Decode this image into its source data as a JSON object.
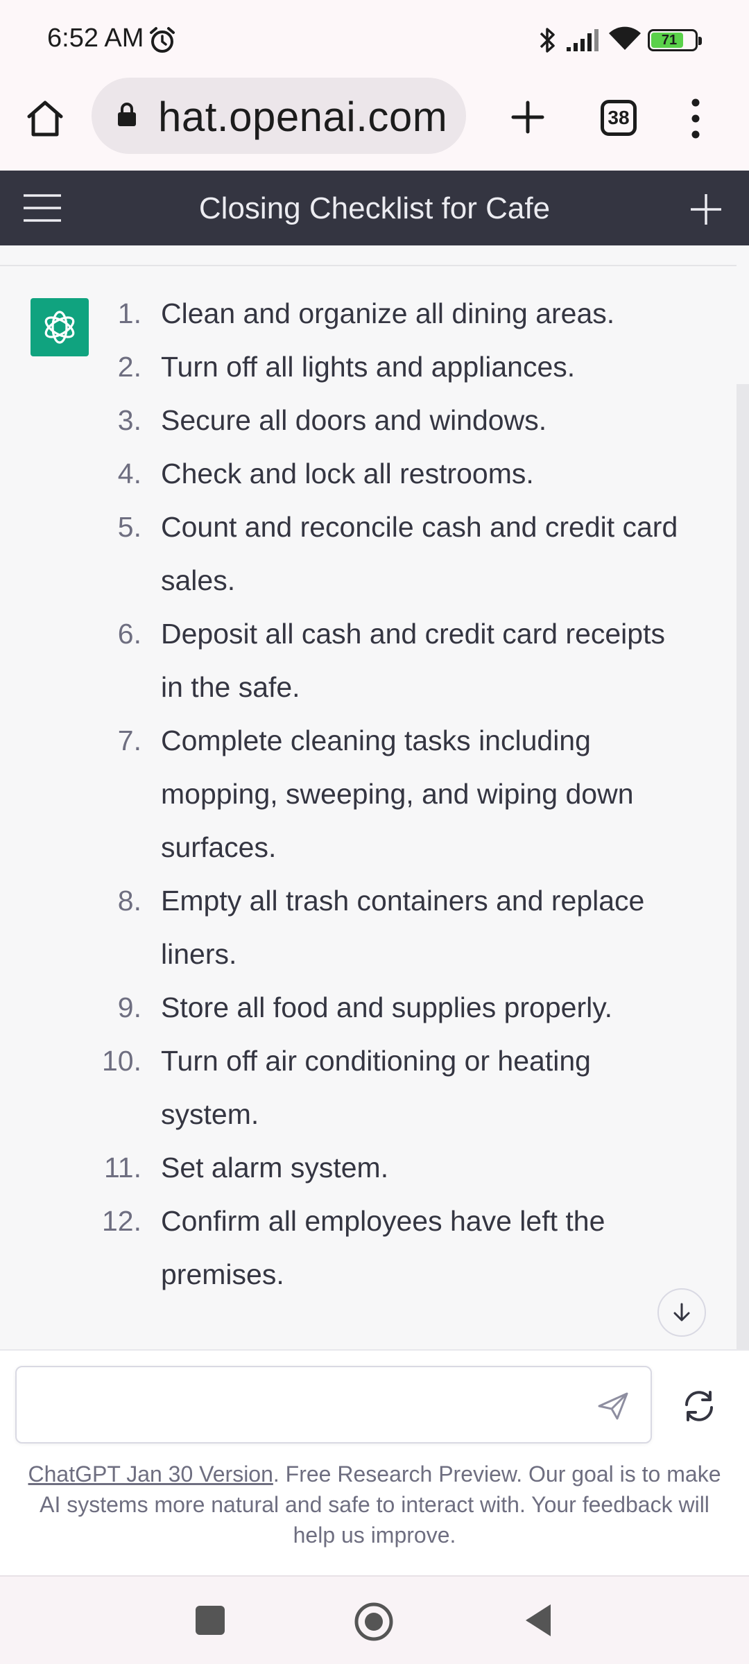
{
  "status_bar": {
    "time": "6:52 AM",
    "battery_level": "71"
  },
  "browser": {
    "url": "hat.openai.com",
    "tab_count": "38"
  },
  "chat_header": {
    "title": "Closing Checklist for Cafe"
  },
  "checklist": {
    "items": [
      {
        "num": "1.",
        "text": "Clean and organize all dining areas."
      },
      {
        "num": "2.",
        "text": "Turn off all lights and appliances."
      },
      {
        "num": "3.",
        "text": "Secure all doors and windows."
      },
      {
        "num": "4.",
        "text": "Check and lock all restrooms."
      },
      {
        "num": "5.",
        "text": "Count and reconcile cash and credit card sales."
      },
      {
        "num": "6.",
        "text": "Deposit all cash and credit card receipts in the safe."
      },
      {
        "num": "7.",
        "text": "Complete cleaning tasks including mopping, sweeping, and wiping down surfaces."
      },
      {
        "num": "8.",
        "text": "Empty all trash containers and replace liners."
      },
      {
        "num": "9.",
        "text": "Store all food and supplies properly."
      },
      {
        "num": "10.",
        "text": "Turn off air conditioning or heating system."
      },
      {
        "num": "11.",
        "text": "Set alarm system."
      },
      {
        "num": "12.",
        "text": "Confirm all employees have left the premises."
      }
    ]
  },
  "input": {
    "placeholder": "",
    "value": ""
  },
  "footer": {
    "link_text": "ChatGPT Jan 30 Version",
    "text": ". Free Research Preview. Our goal is to make AI systems more natural and safe to interact with. Your feedback will help us improve."
  },
  "colors": {
    "header_bg": "#343541",
    "avatar_bg": "#10a37f",
    "battery_fill": "#5ad14a"
  },
  "icons": {
    "alarm": "alarm-clock-icon",
    "bluetooth": "bluetooth-icon",
    "signal": "signal-icon",
    "wifi": "wifi-icon",
    "home": "home-icon",
    "lock": "lock-icon",
    "new_tab": "plus-icon",
    "menu": "more-vert-icon",
    "hamburger": "hamburger-icon",
    "new_chat": "plus-icon",
    "avatar": "openai-logo-icon",
    "scroll_down": "arrow-down-icon",
    "send": "send-icon",
    "regenerate": "refresh-icon"
  }
}
